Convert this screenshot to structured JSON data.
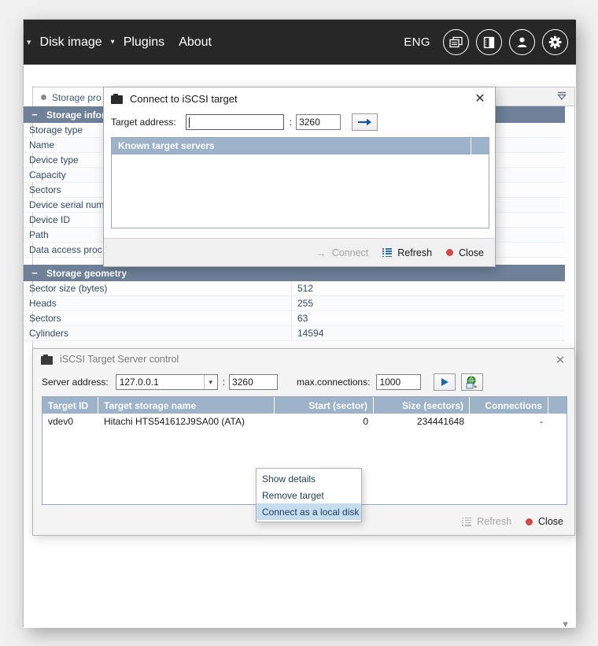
{
  "menubar": {
    "left_caret": "▾",
    "items": [
      {
        "label": "Disk image",
        "has_caret": true
      },
      {
        "label": "Plugins",
        "has_caret": false
      },
      {
        "label": "About",
        "has_caret": false
      }
    ],
    "caret": "▾",
    "language": "ENG",
    "icons": [
      {
        "name": "panels-icon",
        "glyph": "⌸"
      },
      {
        "name": "book-icon",
        "glyph": "◧"
      },
      {
        "name": "user-icon",
        "glyph": "♟"
      },
      {
        "name": "gear-icon",
        "glyph": "⚙"
      }
    ]
  },
  "props_panel": {
    "tab_label": "Storage pro",
    "collapse_icon": "▽",
    "scroll_down_icon": "▼",
    "sections": [
      {
        "title": "Storage information",
        "minus": "−",
        "rows": [
          {
            "key": "Storage type",
            "value": ""
          },
          {
            "key": "Name",
            "value": ""
          },
          {
            "key": "Device type",
            "value": ""
          },
          {
            "key": "Capacity",
            "value": ""
          },
          {
            "key": "Sectors",
            "value": ""
          },
          {
            "key": "Device serial num",
            "value": ""
          },
          {
            "key": "Device ID",
            "value": ""
          },
          {
            "key": "Path",
            "value": ""
          },
          {
            "key": "Data access proc",
            "value": ""
          }
        ]
      },
      {
        "title": "Storage geometry",
        "minus": "−",
        "rows": [
          {
            "key": "Sector size (bytes)",
            "value": "512"
          },
          {
            "key": "Heads",
            "value": "255"
          },
          {
            "key": "Sectors",
            "value": "63"
          },
          {
            "key": "Cylinders",
            "value": "14594"
          }
        ]
      }
    ]
  },
  "dialog_connect": {
    "title": "Connect to iSCSI target",
    "close_glyph": "✕",
    "address_label": "Target address:",
    "address_value": "",
    "address_placeholder": "",
    "colon": ":",
    "port_value": "3260",
    "go_glyph": "→",
    "list_header": "Known target servers",
    "buttons": [
      {
        "name": "connect",
        "label": "Connect",
        "icon": "arrow-right-icon",
        "disabled": true
      },
      {
        "name": "refresh",
        "label": "Refresh",
        "icon": "refresh-list-icon",
        "disabled": false
      },
      {
        "name": "close",
        "label": "Close",
        "icon": "red-dot-icon",
        "disabled": false
      }
    ]
  },
  "panel_iscsi": {
    "title": "iSCSI Target Server control",
    "close_glyph": "✕",
    "server_label": "Server address:",
    "server_value": "127.0.0.1",
    "combo_arrow": "▾",
    "colon": ":",
    "port_value": "3260",
    "maxconn_label": "max.connections:",
    "maxconn_value": "1000",
    "start_button_name": "start-server-button",
    "network_button_name": "network-settings-button",
    "table": {
      "columns": [
        "Target ID",
        "Target storage name",
        "Start (sector)",
        "Size (sectors)",
        "Connections"
      ],
      "rows": [
        {
          "target_id": "vdev0",
          "storage_name": "Hitachi HTS541612J9SA00 (ATA)",
          "start_sector": "0",
          "size_sectors": "234441648",
          "connections": "-"
        }
      ]
    },
    "buttons": [
      {
        "name": "refresh",
        "label": "Refresh",
        "icon": "refresh-list-icon",
        "disabled": true
      },
      {
        "name": "close",
        "label": "Close",
        "icon": "red-dot-icon",
        "disabled": false
      }
    ]
  },
  "context_menu": {
    "items": [
      {
        "label": "Show details",
        "selected": false
      },
      {
        "label": "Remove target",
        "selected": false
      },
      {
        "label": "Connect as a local disk",
        "selected": true
      }
    ]
  },
  "colors": {
    "menubar_bg": "#272727",
    "section_header_bg": "#6e8198",
    "list_header_bg": "#9cb3c9",
    "accent_blue": "#2f6fb5",
    "close_red": "#cf4b45",
    "menu_selection": "#c6dcef",
    "link_text": "#2d4a66"
  }
}
